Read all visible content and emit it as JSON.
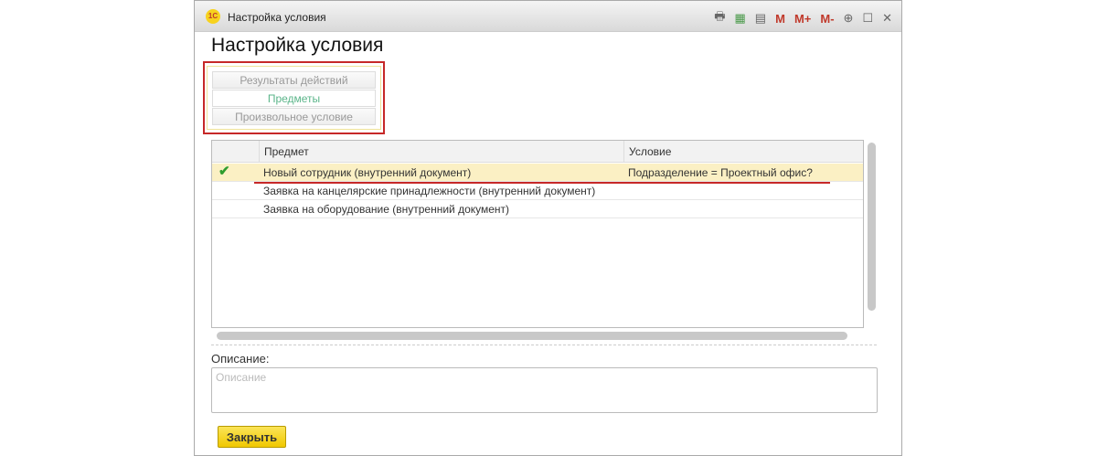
{
  "window": {
    "title": "Настройка условия",
    "logo": "1С",
    "tools": [
      "print-icon",
      "calculator-icon",
      "calendar-icon"
    ],
    "mem": [
      "M",
      "M+",
      "M-"
    ],
    "zoom_icon": "⊕",
    "maximize_icon": "☐",
    "close_icon": "✕"
  },
  "page": {
    "title": "Настройка условия"
  },
  "modes": [
    {
      "label": "Результаты действий",
      "active": false
    },
    {
      "label": "Предметы",
      "active": true
    },
    {
      "label": "Произвольное условие",
      "active": false
    }
  ],
  "table": {
    "columns": [
      "",
      "Предмет",
      "Условие"
    ],
    "rows": [
      {
        "checked": true,
        "check": "✔",
        "subject": "Новый сотрудник (внутренний документ)",
        "condition": "Подразделение = Проектный офис?"
      },
      {
        "checked": false,
        "subject": "Заявка на канцелярские принадлежности (внутренний документ)",
        "condition": ""
      },
      {
        "checked": false,
        "subject": "Заявка на оборудование (внутренний документ)",
        "condition": ""
      }
    ]
  },
  "description": {
    "label": "Описание:",
    "placeholder": "Описание",
    "value": ""
  },
  "close_button": "Закрыть"
}
